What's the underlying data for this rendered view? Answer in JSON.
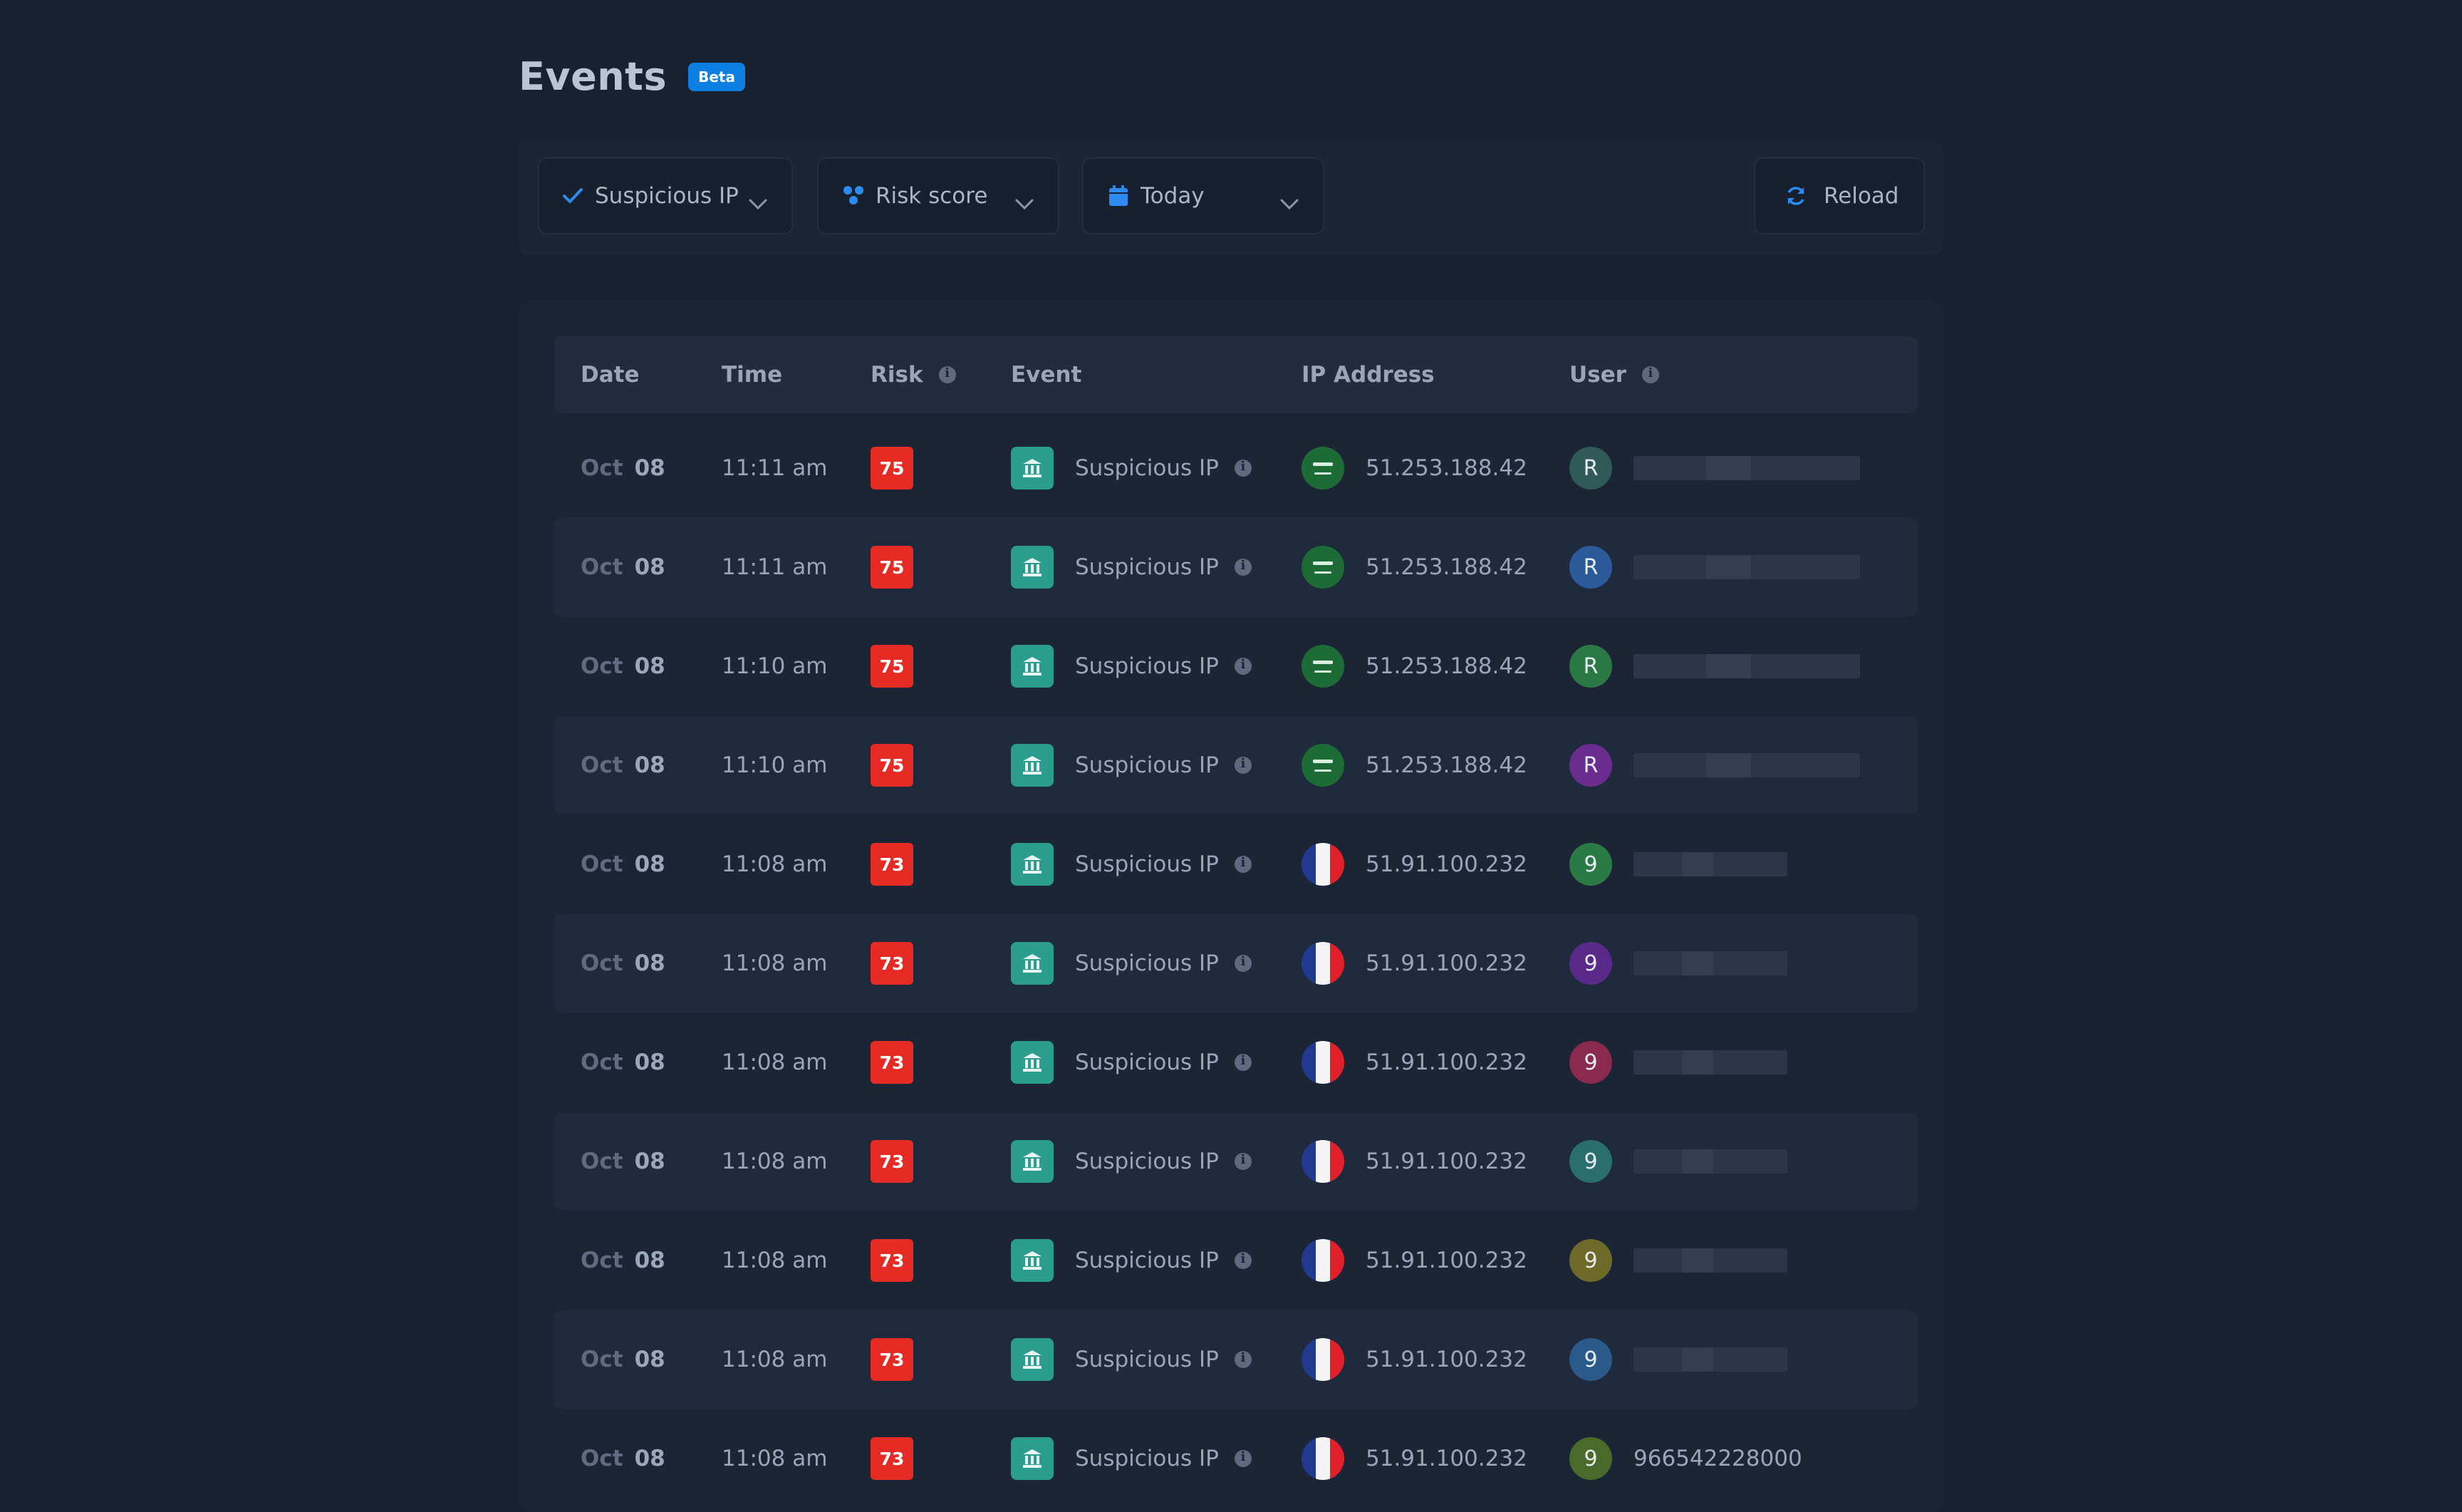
{
  "header": {
    "title": "Events",
    "badge": "Beta"
  },
  "filters": {
    "event_type": "Suspicious IP",
    "risk": "Risk score",
    "date": "Today",
    "reload": "Reload"
  },
  "table": {
    "columns": {
      "date": "Date",
      "time": "Time",
      "risk": "Risk",
      "event": "Event",
      "ip": "IP Address",
      "user": "User"
    },
    "rows": [
      {
        "month": "Oct",
        "day": "08",
        "time": "11:11 am",
        "risk": "75",
        "event": "Suspicious IP",
        "country": "sa",
        "ip": "51.253.188.42",
        "initial": "R",
        "avatar_color": "#2f5a57",
        "user": ""
      },
      {
        "month": "Oct",
        "day": "08",
        "time": "11:11 am",
        "risk": "75",
        "event": "Suspicious IP",
        "country": "sa",
        "ip": "51.253.188.42",
        "initial": "R",
        "avatar_color": "#2b5a9a",
        "user": ""
      },
      {
        "month": "Oct",
        "day": "08",
        "time": "11:10 am",
        "risk": "75",
        "event": "Suspicious IP",
        "country": "sa",
        "ip": "51.253.188.42",
        "initial": "R",
        "avatar_color": "#2b7a45",
        "user": ""
      },
      {
        "month": "Oct",
        "day": "08",
        "time": "11:10 am",
        "risk": "75",
        "event": "Suspicious IP",
        "country": "sa",
        "ip": "51.253.188.42",
        "initial": "R",
        "avatar_color": "#6a2d8f",
        "user": ""
      },
      {
        "month": "Oct",
        "day": "08",
        "time": "11:08 am",
        "risk": "73",
        "event": "Suspicious IP",
        "country": "fr",
        "ip": "51.91.100.232",
        "initial": "9",
        "avatar_color": "#2b7a45",
        "user": ""
      },
      {
        "month": "Oct",
        "day": "08",
        "time": "11:08 am",
        "risk": "73",
        "event": "Suspicious IP",
        "country": "fr",
        "ip": "51.91.100.232",
        "initial": "9",
        "avatar_color": "#5a2a8a",
        "user": ""
      },
      {
        "month": "Oct",
        "day": "08",
        "time": "11:08 am",
        "risk": "73",
        "event": "Suspicious IP",
        "country": "fr",
        "ip": "51.91.100.232",
        "initial": "9",
        "avatar_color": "#8a2a4e",
        "user": ""
      },
      {
        "month": "Oct",
        "day": "08",
        "time": "11:08 am",
        "risk": "73",
        "event": "Suspicious IP",
        "country": "fr",
        "ip": "51.91.100.232",
        "initial": "9",
        "avatar_color": "#2a6e6e",
        "user": ""
      },
      {
        "month": "Oct",
        "day": "08",
        "time": "11:08 am",
        "risk": "73",
        "event": "Suspicious IP",
        "country": "fr",
        "ip": "51.91.100.232",
        "initial": "9",
        "avatar_color": "#6e6a2a",
        "user": ""
      },
      {
        "month": "Oct",
        "day": "08",
        "time": "11:08 am",
        "risk": "73",
        "event": "Suspicious IP",
        "country": "fr",
        "ip": "51.91.100.232",
        "initial": "9",
        "avatar_color": "#2a5a8a",
        "user": ""
      },
      {
        "month": "Oct",
        "day": "08",
        "time": "11:08 am",
        "risk": "73",
        "event": "Suspicious IP",
        "country": "fr",
        "ip": "51.91.100.232",
        "initial": "9",
        "avatar_color": "#4a6a2a",
        "user": "966542228000"
      }
    ]
  },
  "colors": {
    "accent": "#0d7fe3",
    "risk_badge": "#e52b23",
    "event_icon": "#2b9d8f",
    "background": "#182130"
  },
  "icons": {
    "check": "check-icon",
    "risk": "risk-score-icon",
    "calendar": "calendar-icon",
    "reload": "refresh-icon",
    "chevron": "chevron-down-icon",
    "info": "info-icon",
    "event": "building-icon"
  }
}
